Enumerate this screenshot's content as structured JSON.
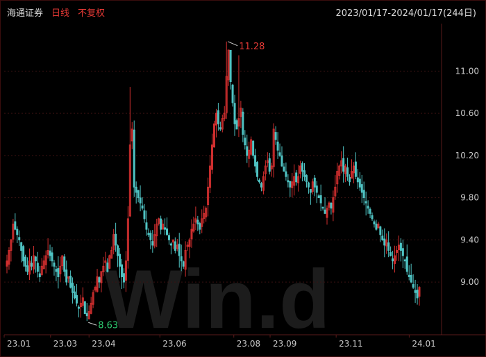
{
  "header": {
    "stock_name": "海通证券",
    "period": "日线",
    "adjust": "不复权",
    "range": "2023/01/17-2024/01/17(244日)"
  },
  "chart_data": {
    "type": "candlestick",
    "title": "海通证券",
    "ylim": [
      8.5,
      11.45
    ],
    "y_ticks": [
      "9.00",
      "9.40",
      "9.80",
      "10.20",
      "10.60",
      "11.00"
    ],
    "x_ticks": [
      "23.01",
      "23.03",
      "23.04",
      "23.06",
      "23.08",
      "23.09",
      "23.11",
      "24.01"
    ],
    "annotations": [
      {
        "text": "11.28",
        "color": "#e53935"
      },
      {
        "text": "8.63",
        "color": "#2ecc71"
      }
    ],
    "watermark": "Win.d",
    "colors": {
      "up": "#d32f2f",
      "down": "#4fc3c3",
      "grid": "#3a1212",
      "axis_text": "#c8c8c8"
    },
    "series": [
      {
        "name": "candles",
        "close": [
          9.2,
          9.3,
          9.4,
          9.55,
          9.5,
          9.45,
          9.4,
          9.3,
          9.2,
          9.15,
          9.1,
          9.2,
          9.15,
          9.25,
          9.2,
          9.1,
          9.05,
          9.15,
          9.2,
          9.25,
          9.3,
          9.25,
          9.2,
          9.15,
          9.1,
          9.05,
          9.15,
          9.25,
          9.1,
          9.0,
          9.05,
          8.95,
          8.9,
          8.85,
          8.8,
          8.75,
          8.8,
          8.85,
          8.7,
          8.68,
          8.72,
          8.8,
          8.9,
          8.95,
          9.05,
          9.0,
          9.1,
          9.15,
          9.2,
          9.1,
          9.25,
          9.3,
          9.45,
          9.35,
          9.25,
          9.15,
          9.05,
          9.0,
          9.2,
          9.6,
          10.3,
          10.45,
          9.9,
          9.85,
          9.8,
          9.75,
          9.7,
          9.6,
          9.5,
          9.45,
          9.4,
          9.35,
          9.45,
          9.55,
          9.6,
          9.5,
          9.55,
          9.5,
          9.45,
          9.4,
          9.35,
          9.4,
          9.3,
          9.35,
          9.25,
          9.2,
          9.15,
          9.3,
          9.35,
          9.4,
          9.5,
          9.55,
          9.6,
          9.55,
          9.5,
          9.6,
          9.65,
          9.7,
          9.9,
          10.1,
          10.3,
          10.5,
          10.6,
          10.5,
          10.45,
          10.55,
          10.6,
          10.95,
          11.2,
          10.9,
          10.7,
          10.5,
          10.45,
          10.55,
          10.65,
          10.4,
          10.3,
          10.2,
          10.25,
          10.35,
          10.2,
          10.1,
          10.0,
          9.95,
          9.9,
          10.0,
          10.1,
          10.15,
          10.05,
          10.1,
          10.45,
          10.35,
          10.25,
          10.2,
          10.1,
          10.05,
          10.0,
          9.95,
          9.9,
          9.95,
          10.0,
          9.95,
          10.0,
          10.1,
          10.05,
          10.0,
          9.95,
          9.9,
          9.85,
          9.95,
          9.9,
          9.85,
          9.8,
          9.75,
          9.7,
          9.65,
          9.7,
          9.75,
          9.7,
          9.8,
          9.9,
          10.05,
          10.1,
          10.15,
          10.05,
          10.1,
          10.0,
          9.95,
          10.05,
          10.1,
          10.0,
          9.95,
          9.9,
          9.85,
          9.8,
          9.75,
          9.7,
          9.65,
          9.6,
          9.55,
          9.5,
          9.55,
          9.45,
          9.4,
          9.35,
          9.4,
          9.3,
          9.25,
          9.2,
          9.25,
          9.3,
          9.35,
          9.3,
          9.25,
          9.2,
          9.1,
          9.05,
          9.0,
          8.95,
          8.9,
          8.85,
          8.95
        ]
      }
    ]
  }
}
